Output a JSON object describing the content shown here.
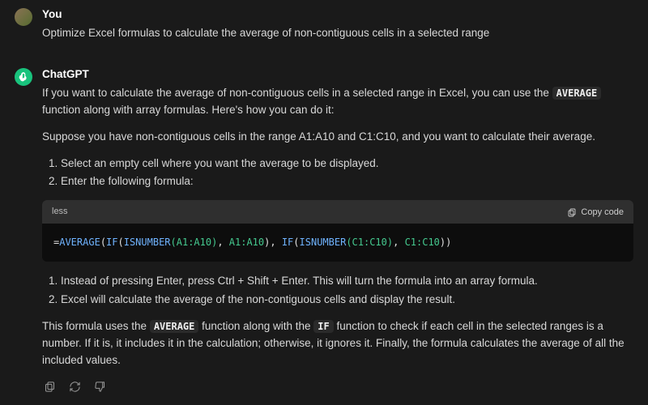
{
  "user": {
    "name": "You",
    "message": "Optimize Excel formulas to calculate the average of non-contiguous cells in a selected range"
  },
  "assistant": {
    "name": "ChatGPT",
    "p1_a": "If you want to calculate the average of non-contiguous cells in a selected range in Excel, you can use the ",
    "p1_code": "AVERAGE",
    "p1_b": " function along with array formulas. Here's how you can do it:",
    "p2": "Suppose you have non-contiguous cells in the range A1:A10 and C1:C10, and you want to calculate their average.",
    "list1": {
      "i1": "Select an empty cell where you want the average to be displayed.",
      "i2": "Enter the following formula:"
    },
    "code": {
      "lang": "less",
      "copy": "Copy code",
      "tokens": {
        "eq": "=",
        "fn_avg": "AVERAGE",
        "op1": "(",
        "fn_if1": "IF",
        "op2": "(",
        "fn_isnum1": "ISNUMBER",
        "arg1a": "(A1:A10)",
        "comma1": ", ",
        "arg1b": "A1:A10",
        "op3": "), ",
        "fn_if2": "IF",
        "op4": "(",
        "fn_isnum2": "ISNUMBER",
        "arg2a": "(C1:C10)",
        "comma2": ", ",
        "arg2b": "C1:C10",
        "op5": "))"
      }
    },
    "list2": {
      "i1": "Instead of pressing Enter, press Ctrl + Shift + Enter. This will turn the formula into an array formula.",
      "i2": "Excel will calculate the average of the non-contiguous cells and display the result."
    },
    "p3_a": "This formula uses the ",
    "p3_code1": "AVERAGE",
    "p3_b": " function along with the ",
    "p3_code2": "IF",
    "p3_c": " function to check if each cell in the selected ranges is a number. If it is, it includes it in the calculation; otherwise, it ignores it. Finally, the formula calculates the average of all the included values."
  }
}
